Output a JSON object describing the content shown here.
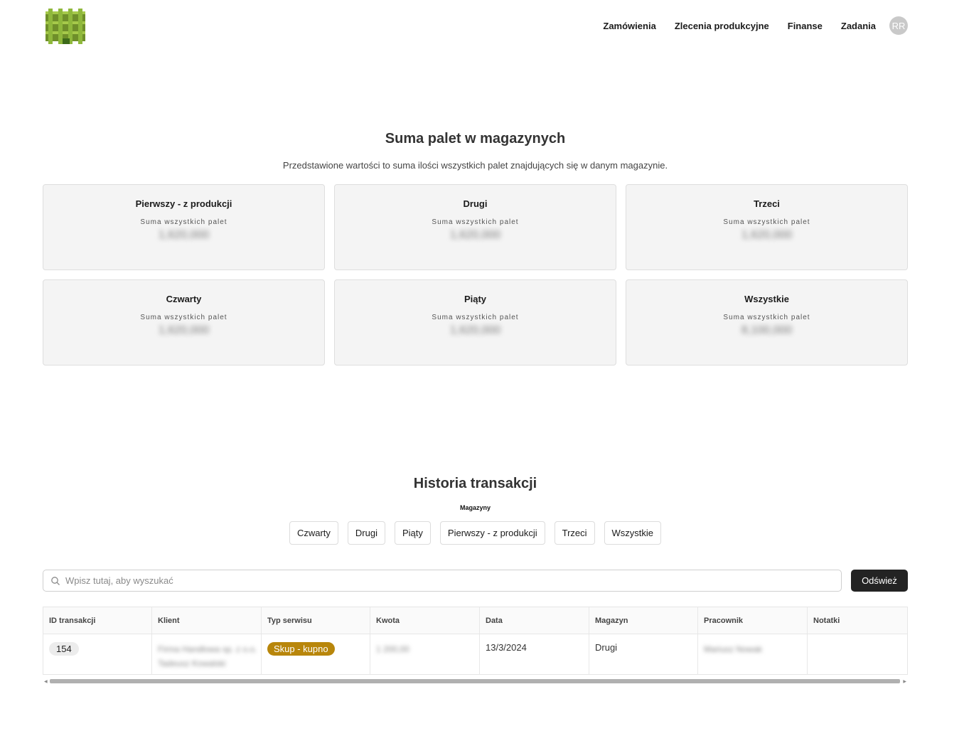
{
  "header": {
    "nav": [
      "Zamówienia",
      "Zlecenia produkcyjne",
      "Finanse",
      "Zadania"
    ],
    "avatar_initials": "RR"
  },
  "summary": {
    "title": "Suma palet w magazynych",
    "subtitle": "Przedstawione wartości to suma ilości wszystkich palet znajdujących się w danym magazynie.",
    "cards": [
      {
        "name": "Pierwszy - z produkcji",
        "label": "Suma wszystkich palet",
        "value": "1,620,000"
      },
      {
        "name": "Drugi",
        "label": "Suma wszystkich palet",
        "value": "1,620,000"
      },
      {
        "name": "Trzeci",
        "label": "Suma wszystkich palet",
        "value": "1,620,000"
      },
      {
        "name": "Czwarty",
        "label": "Suma wszystkich palet",
        "value": "1,620,000"
      },
      {
        "name": "Piąty",
        "label": "Suma wszystkich palet",
        "value": "1,620,000"
      },
      {
        "name": "Wszystkie",
        "label": "Suma wszystkich palet",
        "value": "8,100,000"
      }
    ]
  },
  "history": {
    "title": "Historia transakcji",
    "filter_label": "Magazyny",
    "filters": [
      "Czwarty",
      "Drugi",
      "Piąty",
      "Pierwszy - z produkcji",
      "Trzeci",
      "Wszystkie"
    ],
    "search_placeholder": "Wpisz tutaj, aby wyszukać",
    "refresh_label": "Odśwież",
    "columns": [
      "ID transakcji",
      "Klient",
      "Typ serwisu",
      "Kwota",
      "Data",
      "Magazyn",
      "Pracownik",
      "Notatki"
    ],
    "rows": [
      {
        "id": "154",
        "client_line1": "Firma Handlowa sp. z o.o.",
        "client_line2": "Tadeusz Kowalski",
        "service": "Skup - kupno",
        "amount": "1 200,00",
        "date": "13/3/2024",
        "warehouse": "Drugi",
        "employee": "Mariusz Nowak",
        "notes": ""
      }
    ]
  },
  "colors": {
    "service_badge": "#b8860b",
    "refresh_button": "#232323",
    "card_bg": "#f4f4f4"
  }
}
